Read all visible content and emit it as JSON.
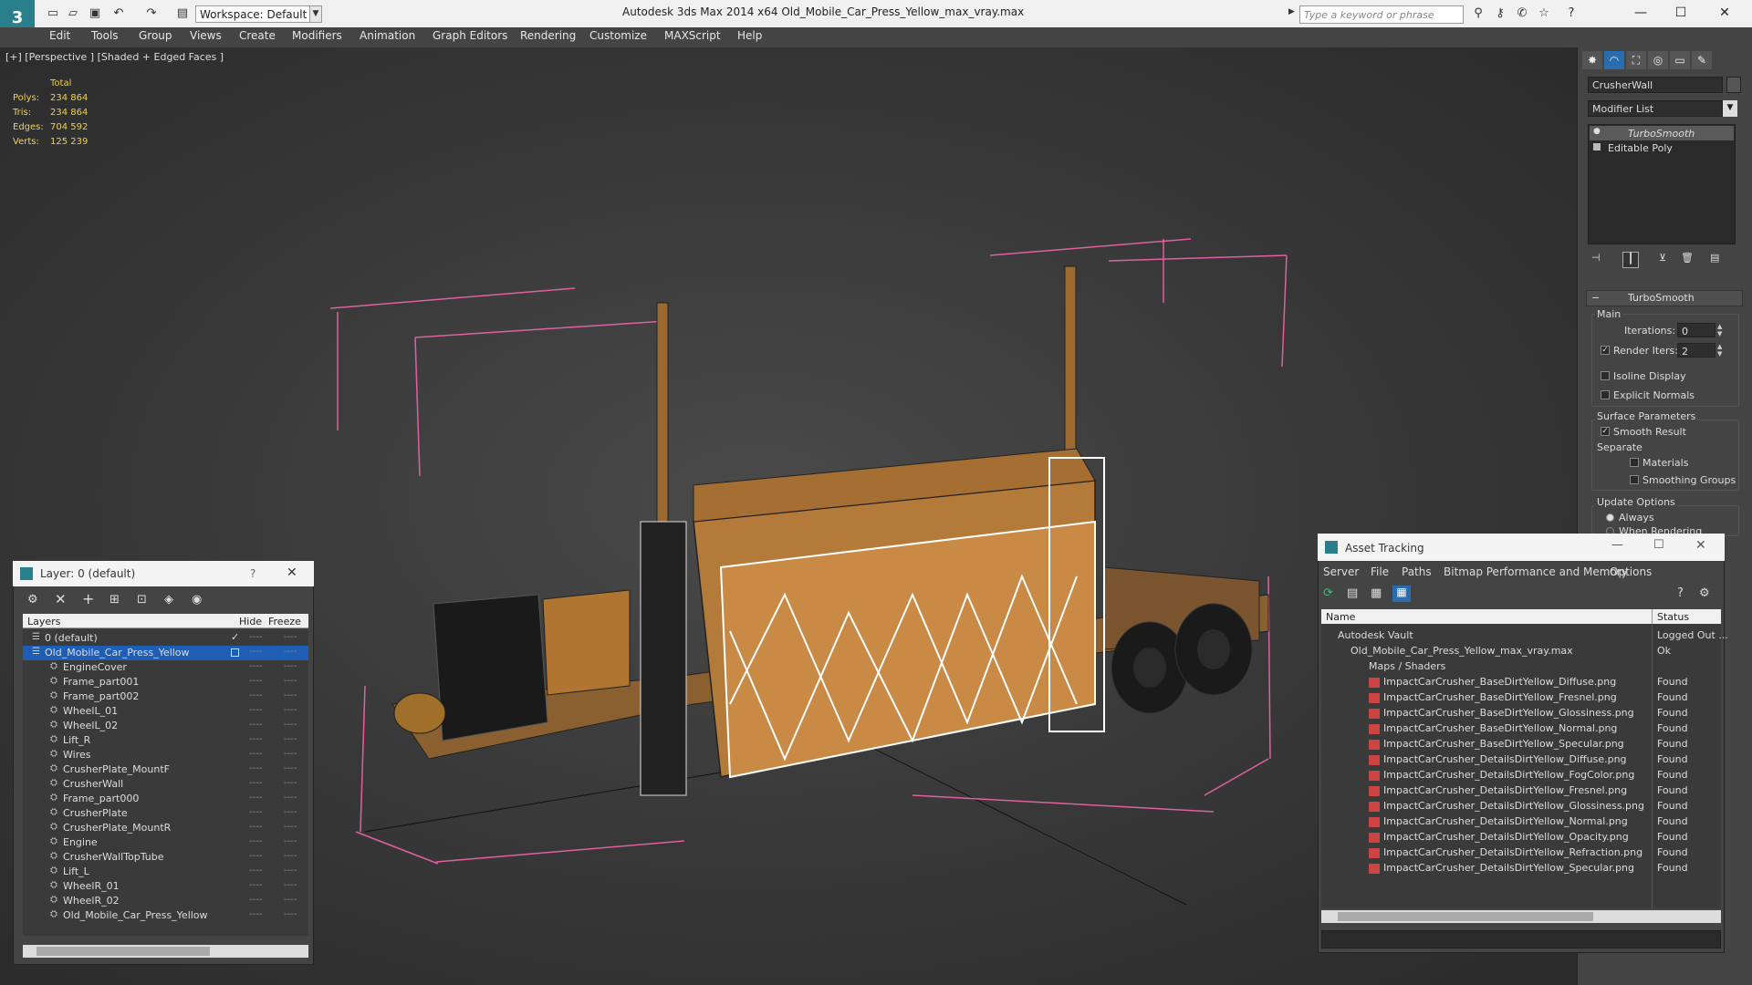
{
  "app": {
    "window_title": "Autodesk 3ds Max  2014 x64      Old_Mobile_Car_Press_Yellow_max_vray.max",
    "workspace": "Workspace: Default",
    "search_placeholder": "Type a keyword or phrase"
  },
  "menu": [
    "Edit",
    "Tools",
    "Group",
    "Views",
    "Create",
    "Modifiers",
    "Animation",
    "Graph Editors",
    "Rendering",
    "Customize",
    "MAXScript",
    "Help"
  ],
  "viewport": {
    "label": "[+] [Perspective ] [Shaded + Edged Faces ]",
    "stats_header": "Total",
    "stats": [
      {
        "label": "Polys:",
        "value": "234 864"
      },
      {
        "label": "Tris:",
        "value": "234 864"
      },
      {
        "label": "Edges:",
        "value": "704 592"
      },
      {
        "label": "Verts:",
        "value": "125 239"
      }
    ]
  },
  "command_panel": {
    "object_name": "CrusherWall",
    "modifier_list": "Modifier List",
    "stack": [
      "TurboSmooth",
      "Editable Poly"
    ],
    "rollout_title": "TurboSmooth",
    "main_label": "Main",
    "iterations_label": "Iterations:",
    "iterations_value": "0",
    "render_iters_label": "Render Iters:",
    "render_iters_value": "2",
    "isoline_label": "Isoline Display",
    "explicit_normals_label": "Explicit Normals",
    "surface_params_label": "Surface Parameters",
    "smooth_result_label": "Smooth Result",
    "separate_label": "Separate",
    "materials_label": "Materials",
    "smoothing_groups_label": "Smoothing Groups",
    "update_options_label": "Update Options",
    "always_label": "Always",
    "when_rendering_label": "When Rendering"
  },
  "layer_panel": {
    "title": "Layer: 0 (default)",
    "help": "?",
    "col_layers": "Layers",
    "col_hide": "Hide",
    "col_freeze": "Freeze",
    "rows": [
      "0 (default)",
      "Old_Mobile_Car_Press_Yellow",
      "EngineCover",
      "Frame_part001",
      "Frame_part002",
      "WheelL_01",
      "WheelL_02",
      "Lift_R",
      "Wires",
      "CrusherPlate_MountF",
      "CrusherWall",
      "Frame_part000",
      "CrusherPlate",
      "CrusherPlate_MountR",
      "Engine",
      "CrusherWallTopTube",
      "Lift_L",
      "WheelR_01",
      "WheelR_02",
      "Old_Mobile_Car_Press_Yellow"
    ],
    "dash": "----"
  },
  "asset_panel": {
    "title": "Asset Tracking",
    "menu": [
      "Server",
      "File",
      "Paths",
      "Bitmap Performance and Memory",
      "Options"
    ],
    "col_name": "Name",
    "col_status": "Status",
    "vault": {
      "name": "Autodesk Vault",
      "status": "Logged Out ..."
    },
    "max_file": {
      "name": "Old_Mobile_Car_Press_Yellow_max_vray.max",
      "status": "Ok"
    },
    "maps_folder": "Maps / Shaders",
    "files": [
      {
        "name": "ImpactCarCrusher_BaseDirtYellow_Diffuse.png",
        "status": "Found"
      },
      {
        "name": "ImpactCarCrusher_BaseDirtYellow_Fresnel.png",
        "status": "Found"
      },
      {
        "name": "ImpactCarCrusher_BaseDirtYellow_Glossiness.png",
        "status": "Found"
      },
      {
        "name": "ImpactCarCrusher_BaseDirtYellow_Normal.png",
        "status": "Found"
      },
      {
        "name": "ImpactCarCrusher_BaseDirtYellow_Specular.png",
        "status": "Found"
      },
      {
        "name": "ImpactCarCrusher_DetailsDirtYellow_Diffuse.png",
        "status": "Found"
      },
      {
        "name": "ImpactCarCrusher_DetailsDirtYellow_FogColor.png",
        "status": "Found"
      },
      {
        "name": "ImpactCarCrusher_DetailsDirtYellow_Fresnel.png",
        "status": "Found"
      },
      {
        "name": "ImpactCarCrusher_DetailsDirtYellow_Glossiness.png",
        "status": "Found"
      },
      {
        "name": "ImpactCarCrusher_DetailsDirtYellow_Normal.png",
        "status": "Found"
      },
      {
        "name": "ImpactCarCrusher_DetailsDirtYellow_Opacity.png",
        "status": "Found"
      },
      {
        "name": "ImpactCarCrusher_DetailsDirtYellow_Refraction.png",
        "status": "Found"
      },
      {
        "name": "ImpactCarCrusher_DetailsDirtYellow_Specular.png",
        "status": "Found"
      }
    ]
  },
  "colors": {
    "accent": "#1e5eb4",
    "stats_yellow": "#f0d050",
    "model_orange": "#c58a3e",
    "selection_box": "#e060a0"
  }
}
